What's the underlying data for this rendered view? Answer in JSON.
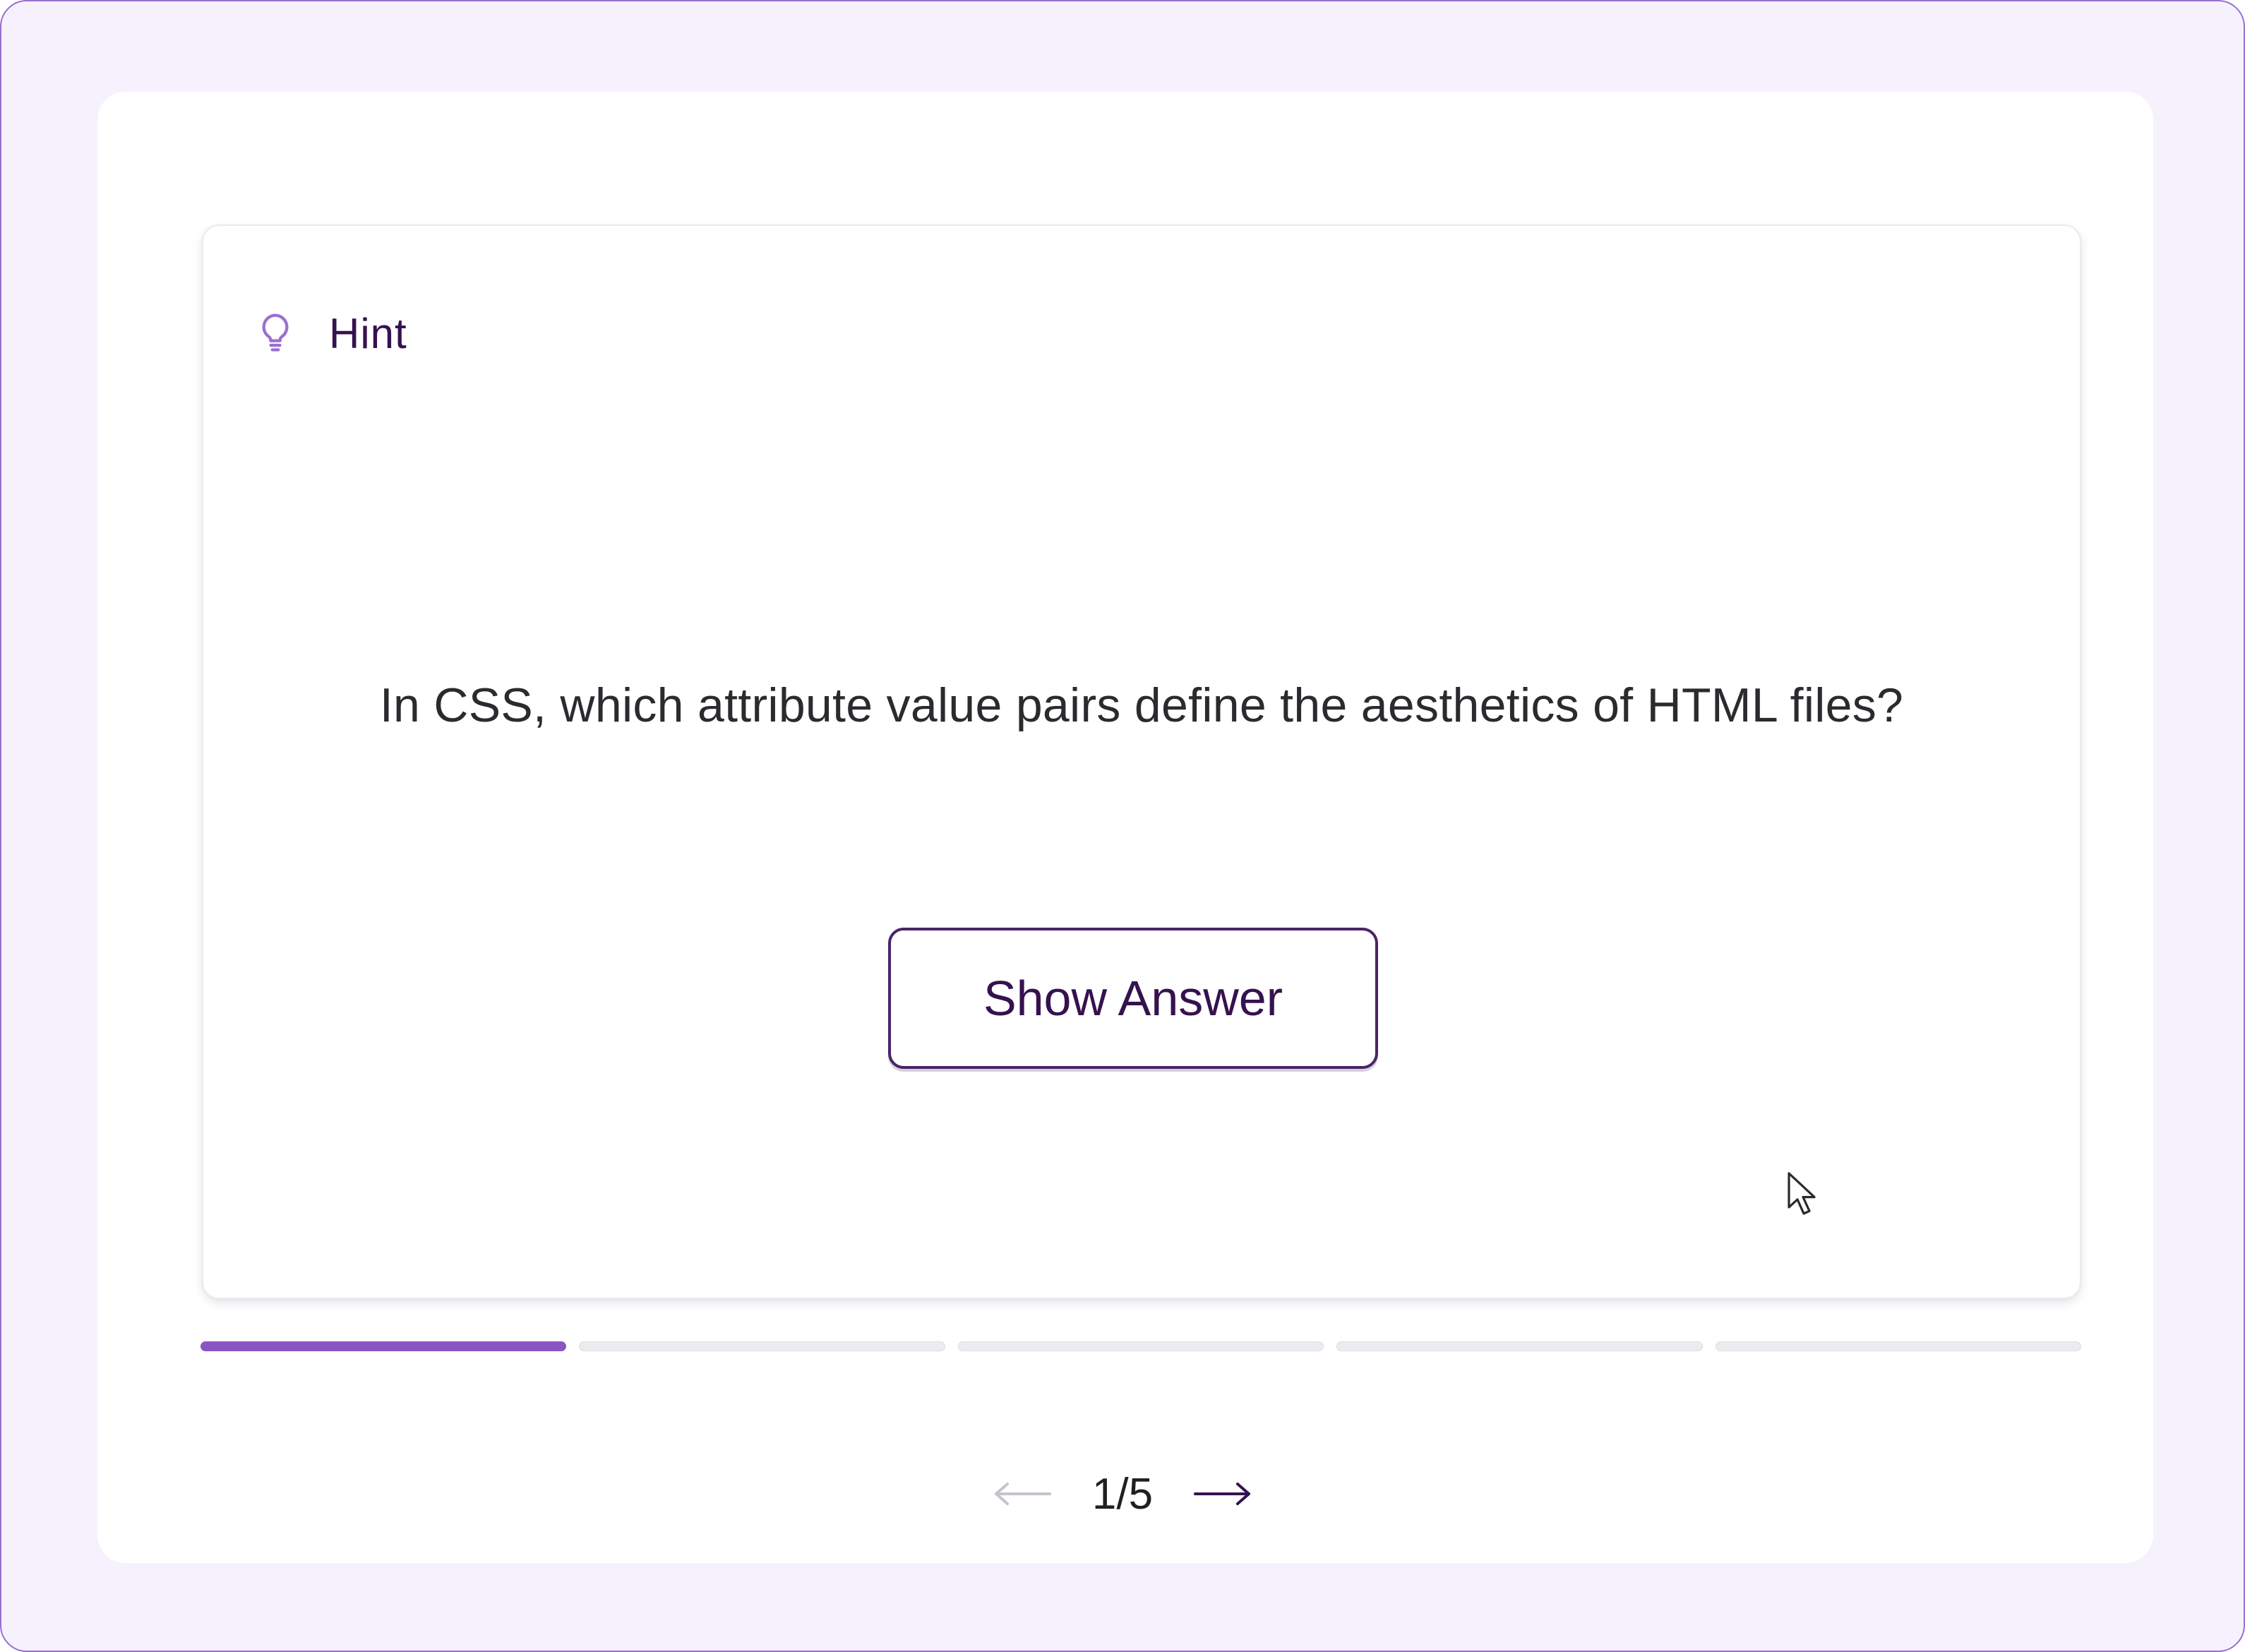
{
  "hint": {
    "label": "Hint",
    "icon": "lightbulb-icon",
    "icon_color": "#9a6fd0"
  },
  "question": {
    "text": "In CSS, which attribute value pairs define the aesthetics of HTML files?"
  },
  "show_answer": {
    "label": "Show Answer"
  },
  "progress": {
    "current": 1,
    "total": 5,
    "active_color": "#8a55c2"
  },
  "pager": {
    "indicator": "1/5",
    "prev_icon": "arrow-left-icon",
    "next_icon": "arrow-right-icon",
    "prev_enabled": false,
    "next_enabled": true
  },
  "colors": {
    "frame_background": "#f6f2fd",
    "frame_border": "#9a6fd0",
    "text_dark_purple": "#35124f"
  }
}
